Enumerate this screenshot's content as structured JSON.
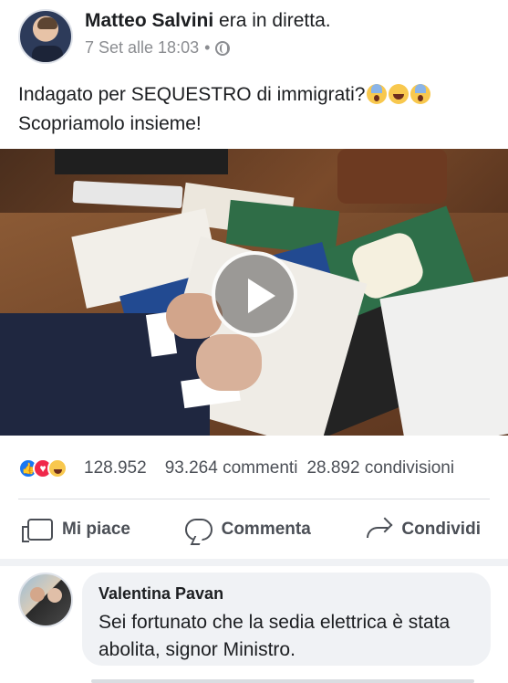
{
  "post": {
    "author": "Matteo Salvini",
    "status": "era in diretta.",
    "timestamp": "7 Set alle 18:03",
    "separator": "•",
    "text_line1": "Indagato per SEQUESTRO di immigrati?",
    "text_line2": "Scopriamolo insieme!"
  },
  "video": {
    "play_icon": "play-icon"
  },
  "reactions": {
    "count": "128.952",
    "comments": "93.264 commenti",
    "shares": "28.892 condivisioni",
    "icons": [
      "like-icon",
      "love-icon",
      "haha-icon"
    ]
  },
  "actions": {
    "like": "Mi piace",
    "comment": "Commenta",
    "share": "Condividi"
  },
  "comment": {
    "author": "Valentina Pavan",
    "text": "Sei fortunato che la sedia elettrica è stata abolita, signor Ministro."
  },
  "colors": {
    "facebook_blue": "#1877f2",
    "love_red": "#f0284a",
    "text_gray": "#4b4f56",
    "bubble_gray": "#f0f2f5"
  }
}
